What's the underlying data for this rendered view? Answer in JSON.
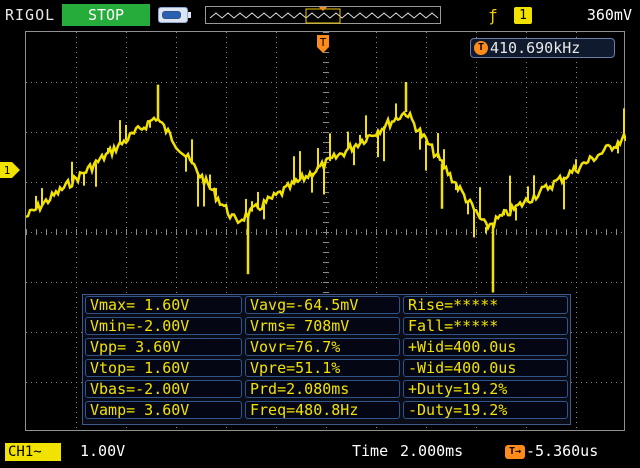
{
  "header": {
    "brand": "RIGOL",
    "run_status": "STOP",
    "trigger_source": "1",
    "trigger_level": "360mV"
  },
  "frequency_readout": {
    "icon": "T",
    "value": "410.690kHz"
  },
  "trigger_position": {
    "label": "T"
  },
  "channel_marker": {
    "label": "1"
  },
  "measurements": [
    [
      "Vmax= 1.60V",
      "Vavg=-64.5mV",
      "Rise=*****"
    ],
    [
      "Vmin=-2.00V",
      "Vrms= 708mV",
      "Fall=*****"
    ],
    [
      "Vpp= 3.60V",
      "Vovr=76.7%",
      "+Wid=400.0us"
    ],
    [
      "Vtop= 1.60V",
      "Vpre=51.1%",
      "-Wid=400.0us"
    ],
    [
      "Vbas=-2.00V",
      "Prd=2.080ms",
      "+Duty=19.2%"
    ],
    [
      "Vamp= 3.60V",
      "Freq=480.8Hz",
      "-Duty=19.2%"
    ]
  ],
  "footer": {
    "channel_label": "CH1",
    "coupling_symbol": "~",
    "channel_scale": "1.00V",
    "time_label": "Time",
    "time_value": "2.000ms",
    "trigger_offset_icon": "T→",
    "trigger_offset": "-5.360us"
  },
  "colors": {
    "trace": "#f2e200",
    "grid": "#8a8a8a",
    "stop_badge": "#26ac3a",
    "trigger_orange": "#ff8c1a"
  }
}
